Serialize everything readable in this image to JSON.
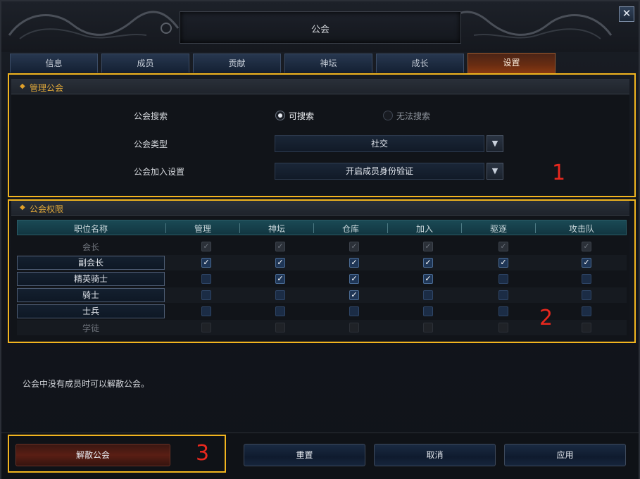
{
  "window": {
    "title": "公会",
    "close_glyph": "✕"
  },
  "tabs": [
    {
      "label": "信息",
      "active": false
    },
    {
      "label": "成员",
      "active": false
    },
    {
      "label": "贡献",
      "active": false
    },
    {
      "label": "神坛",
      "active": false
    },
    {
      "label": "成长",
      "active": false
    },
    {
      "label": "设置",
      "active": true
    }
  ],
  "manage": {
    "heading": "管理公会",
    "search_label": "公会搜索",
    "search_options": [
      {
        "label": "可搜索",
        "selected": true
      },
      {
        "label": "无法搜索",
        "selected": false
      }
    ],
    "type_label": "公会类型",
    "type_value": "社交",
    "join_label": "公会加入设置",
    "join_value": "开启成员身份验证"
  },
  "permissions": {
    "heading": "公会权限",
    "columns": [
      "职位名称",
      "管理",
      "神坛",
      "仓库",
      "加入",
      "驱逐",
      "攻击队"
    ],
    "rows": [
      {
        "role": "会长",
        "editable": false,
        "perms": [
          "locked-on",
          "locked-on",
          "locked-on",
          "locked-on",
          "locked-on",
          "locked-on"
        ]
      },
      {
        "role": "副会长",
        "editable": true,
        "perms": [
          "on",
          "on",
          "on",
          "on",
          "on",
          "on"
        ]
      },
      {
        "role": "精英骑士",
        "editable": true,
        "perms": [
          "off",
          "on",
          "on",
          "on",
          "off",
          "off"
        ]
      },
      {
        "role": "骑士",
        "editable": true,
        "perms": [
          "off",
          "off",
          "on",
          "off",
          "off",
          "off"
        ]
      },
      {
        "role": "士兵",
        "editable": true,
        "perms": [
          "off",
          "off",
          "off",
          "off",
          "off",
          "off"
        ]
      },
      {
        "role": "学徒",
        "editable": false,
        "perms": [
          "locked-off",
          "locked-off",
          "locked-off",
          "locked-off",
          "locked-off",
          "locked-off"
        ]
      }
    ]
  },
  "info_text": "公会中没有成员时可以解散公会。",
  "footer": {
    "disband": "解散公会",
    "reset": "重置",
    "cancel": "取消",
    "apply": "应用"
  },
  "annotations": [
    "1",
    "2",
    "3"
  ],
  "colors": {
    "accent_gold": "#e2aa3a",
    "highlight_box": "#f2b51f",
    "annotation_number": "#e8281e",
    "active_tab": "#6b2d12"
  }
}
